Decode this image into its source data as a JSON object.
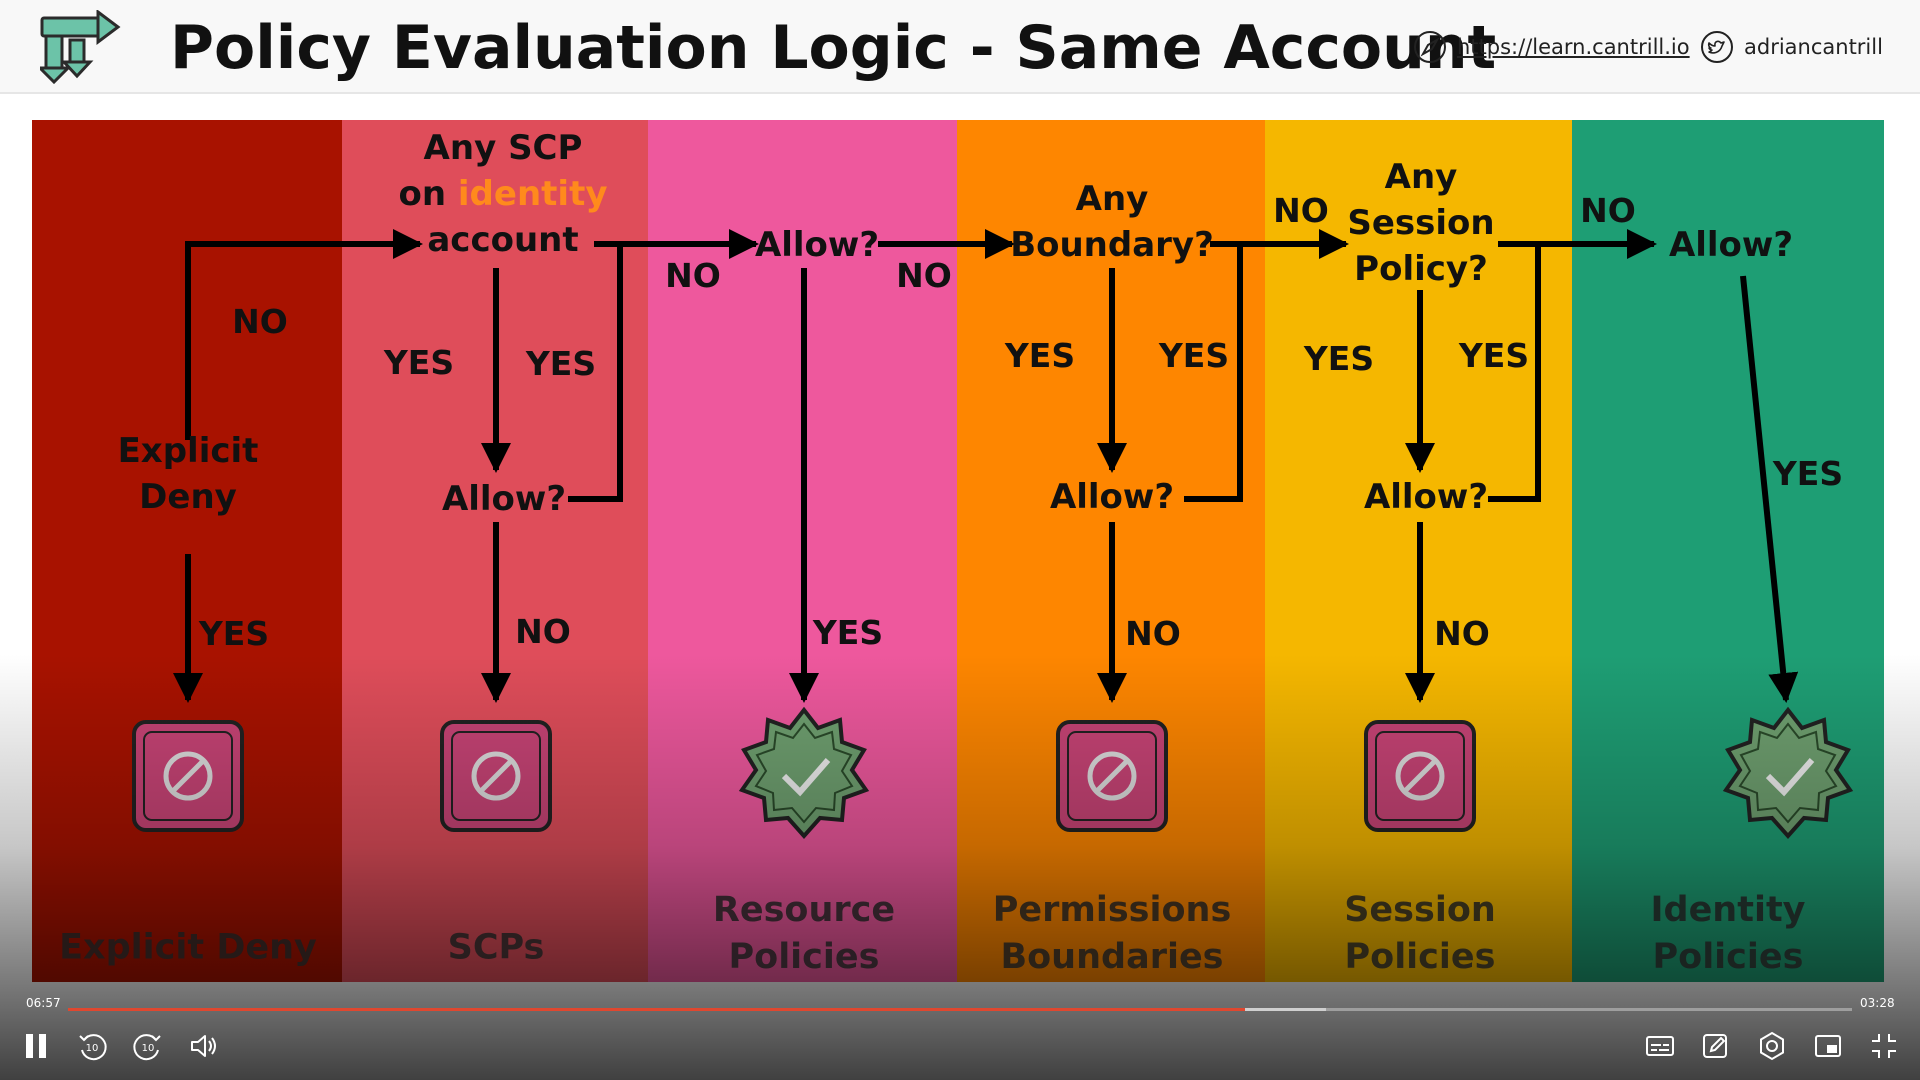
{
  "header": {
    "title": "Policy Evaluation Logic - Same Account",
    "site_link": "https://learn.cantrill.io",
    "twitter_handle": "adriancantrill",
    "icons": [
      "arrows-logo-icon",
      "compass-icon",
      "twitter-bird-icon"
    ]
  },
  "colors": {
    "explicit_deny": "#a81200",
    "scps": "#df4d5a",
    "resource_policies": "#ee589d",
    "permissions_boundaries": "#fe8600",
    "session_policies": "#f5b700",
    "identity_policies": "#1e9e74",
    "deny_icon": "#c84476",
    "allow_icon": "#6fa070"
  },
  "diagram": {
    "nodes": {
      "explicit_deny": [
        "Explicit",
        "Deny"
      ],
      "scp_question": [
        "Any SCP",
        "on ",
        "identity",
        "account"
      ],
      "scp_allow": "Allow?",
      "resource_allow": "Allow?",
      "boundary_question": [
        "Any",
        "Boundary?"
      ],
      "boundary_allow": "Allow?",
      "session_question": [
        "Any",
        "Session",
        "Policy?"
      ],
      "session_allow": "Allow?",
      "identity_allow": "Allow?"
    },
    "edge_labels": {
      "deny_no": "NO",
      "deny_yes": "YES",
      "scp_yes_left": "YES",
      "scp_yes_right": "YES",
      "scp_no": "NO",
      "resource_no_left": "NO",
      "resource_no_right": "NO",
      "resource_yes": "YES",
      "boundary_yes_left": "YES",
      "boundary_yes_right": "YES",
      "boundary_no": "NO",
      "session_no_in": "NO",
      "session_yes_left": "YES",
      "session_yes_right": "YES",
      "session_no": "NO",
      "identity_no_in": "NO",
      "identity_yes": "YES"
    },
    "outcomes": [
      "deny",
      "deny",
      "allow",
      "deny",
      "deny",
      "allow"
    ],
    "columns": [
      [
        "Explicit Deny"
      ],
      [
        "SCPs"
      ],
      [
        "Resource",
        "Policies"
      ],
      [
        "Permissions",
        "Boundaries"
      ],
      [
        "Session",
        "Policies"
      ],
      [
        "Identity",
        "Policies"
      ]
    ]
  },
  "player": {
    "time_elapsed": "06:57",
    "time_total": "03:28",
    "progress": 0.66,
    "buffered": 0.705,
    "controls": [
      "pause-icon",
      "rewind-10-icon",
      "forward-10-icon",
      "volume-icon",
      "subtitles-icon",
      "notes-icon",
      "settings-icon",
      "picture-in-picture-icon",
      "exit-fullscreen-icon"
    ],
    "rewind_seconds": "10",
    "forward_seconds": "10"
  }
}
